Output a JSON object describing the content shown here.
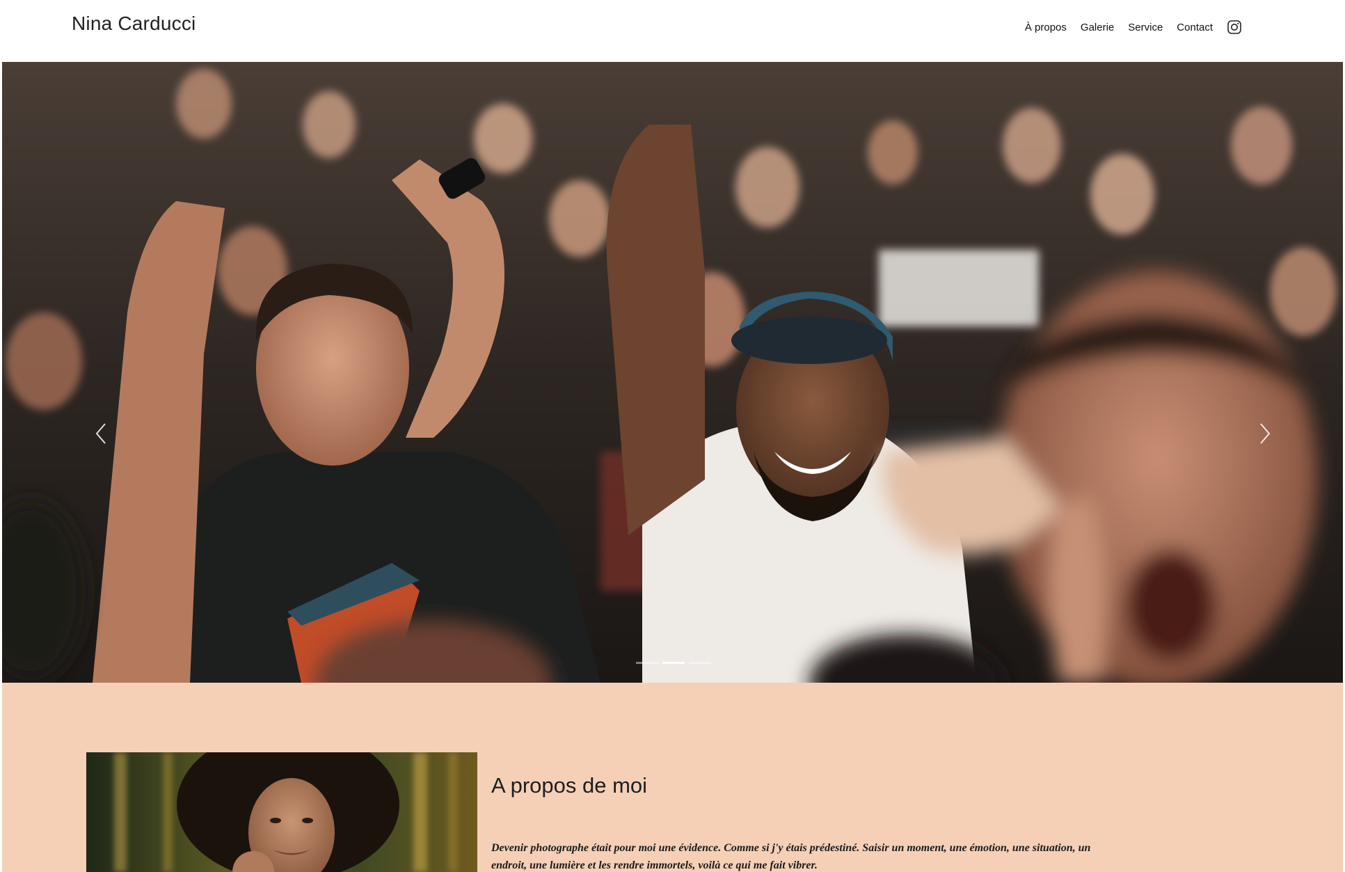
{
  "header": {
    "brand": "Nina Carducci",
    "nav": [
      {
        "label": "À propos"
      },
      {
        "label": "Galerie"
      },
      {
        "label": "Service"
      },
      {
        "label": "Contact"
      }
    ],
    "instagram_icon": "instagram-icon"
  },
  "hero": {
    "image": "concert-crowd-photo",
    "prev_icon": "chevron-left-icon",
    "next_icon": "chevron-right-icon",
    "slides_total": 3,
    "active_slide": 2
  },
  "about": {
    "image": "portrait-photo",
    "title": "A propos de moi",
    "text": "Devenir photographe était pour moi une évidence. Comme si j'y étais prédestiné. Saisir un moment, une émotion, une situation, un endroit, une lumière et les rendre immortels, voilà ce qui me fait vibrer."
  },
  "colors": {
    "about_background": "#f5d0b7",
    "header_background": "#ffffff",
    "text": "#1a1a1a"
  }
}
